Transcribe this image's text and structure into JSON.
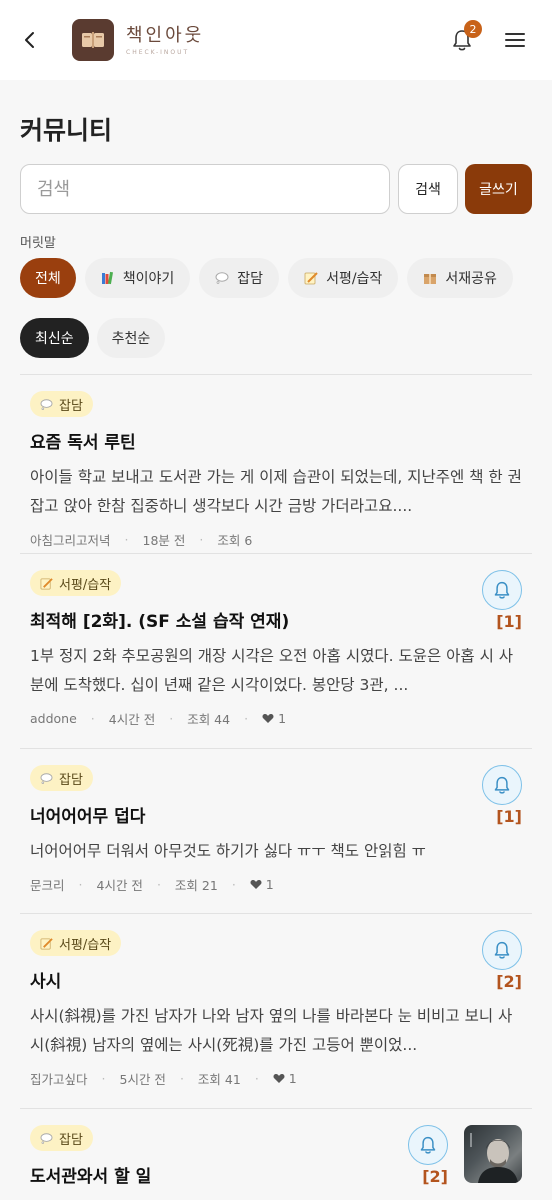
{
  "header": {
    "logo_title": "책인아웃",
    "logo_subtitle": "CHECK-INOUT",
    "notification_count": "2"
  },
  "page": {
    "title": "커뮤니티"
  },
  "search": {
    "placeholder": "검색",
    "button_label": "검색",
    "write_label": "글쓰기"
  },
  "prefix": {
    "label": "머릿말",
    "chips": [
      {
        "label": "전체",
        "icon": "none"
      },
      {
        "label": "책이야기",
        "icon": "books-icon"
      },
      {
        "label": "잡담",
        "icon": "speech-bubble-icon"
      },
      {
        "label": "서평/습작",
        "icon": "memo-icon"
      },
      {
        "label": "서재공유",
        "icon": "package-icon"
      }
    ]
  },
  "sort": {
    "chips": [
      "최신순",
      "추천순"
    ]
  },
  "posts": [
    {
      "tag": "잡담",
      "title": "요즘 독서 루틴",
      "body": "아이들 학교 보내고 도서관 가는 게 이제 습관이 되었는데, 지난주엔 책 한 권 잡고 앉아 한참 집중하니 생각보다 시간 금방 가더라고요....",
      "author": "아침그리고저녁",
      "time": "18분 전",
      "views": "조회 6",
      "likes": "",
      "count": ""
    },
    {
      "tag": "서평/습작",
      "title": "최적해 [2화]. (SF 소설 습작 연재)",
      "body": "1부 정지 2화 추모공원의 개장 시각은 오전 아홉 시였다. 도윤은 아홉 시 사 분에 도착했다. 십이 년째 같은 시각이었다. 봉안당 3관, ...",
      "author": "addone",
      "time": "4시간 전",
      "views": "조회 44",
      "likes": "1",
      "count": "[1]"
    },
    {
      "tag": "잡담",
      "title": "너어어어무 덥다",
      "body": "너어어어무 더워서 아무것도 하기가 싫다 ㅠㅜ 책도 안읽힘 ㅠ",
      "author": "문크리",
      "time": "4시간 전",
      "views": "조회 21",
      "likes": "1",
      "count": "[1]"
    },
    {
      "tag": "서평/습작",
      "title": "사시",
      "body": "사시(斜視)를 가진 남자가 나와 남자 옆의 나를 바라본다 눈 비비고 보니 사시(斜視) 남자의 옆에는 사시(死視)를 가진 고등어 뿐이었...",
      "author": "집가고싶다",
      "time": "5시간 전",
      "views": "조회 41",
      "likes": "1",
      "count": "[2]"
    },
    {
      "tag": "잡담",
      "title": "도서관와서 할 일",
      "body": "",
      "author": "",
      "time": "",
      "views": "",
      "likes": "",
      "count": "[2]"
    }
  ],
  "colors": {
    "brand": "#8a3a0a",
    "active_chip": "#9a3f0e",
    "badge": "#c86219",
    "tag_bg": "#fdf2c4",
    "count": "#b3541e",
    "bell_border": "#7ec1e8"
  }
}
